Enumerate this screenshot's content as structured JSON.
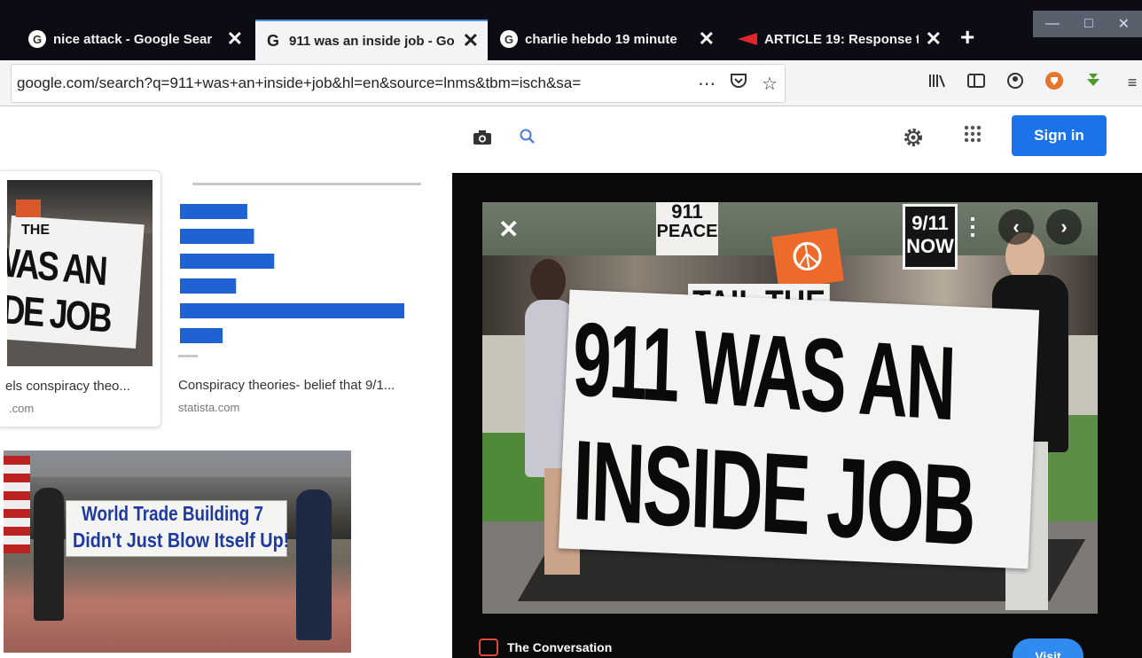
{
  "browser": {
    "tabs": [
      {
        "title": "nice attack - Google Sear",
        "favicon": "google-icon",
        "active": false
      },
      {
        "title": "911 was an inside job - Go",
        "favicon": "google-g-icon",
        "active": true
      },
      {
        "title": "charlie hebdo 19 minute",
        "favicon": "google-icon",
        "active": false
      },
      {
        "title": "ARTICLE 19: Response to",
        "favicon": "article19-flag-icon",
        "active": false
      }
    ],
    "close_glyph": "✕",
    "new_tab_glyph": "+",
    "url": "google.com/search?q=911+was+an+inside+job&hl=en&source=lnms&tbm=isch&sa=",
    "url_overflow": "",
    "window_controls": [
      "—",
      "□",
      "✕"
    ],
    "toolbar_icons": [
      "library-icon",
      "sidebar-icon",
      "account-icon",
      "ublock-icon",
      "download-icon",
      "menu-icon"
    ]
  },
  "google": {
    "sign_in_label": "Sign in",
    "accent": "#1a73e8"
  },
  "results": [
    {
      "caption": "els conspiracy theo...",
      "source": ".com"
    },
    {
      "caption": "Conspiracy theories- belief that 9/1...",
      "source": "statista.com"
    }
  ],
  "mini_chart": {
    "values": [
      30,
      33,
      42,
      25,
      100,
      19
    ]
  },
  "thumb_banners": {
    "left_card": [
      "THE",
      "WAS AN",
      "DE JOB"
    ],
    "march": [
      "World Trade Building 7",
      "Didn't Just Blow Itself Up!"
    ]
  },
  "preview": {
    "banner_line1": "911 WAS AN",
    "banner_line2": "INSIDE JOB",
    "sign_peace": [
      "911",
      "PEACE"
    ],
    "sign_tail": "TAIL THE",
    "sign_now": [
      "9/11",
      "NOW"
    ],
    "source_name": "The Conversation",
    "visit_label": "Visit"
  }
}
